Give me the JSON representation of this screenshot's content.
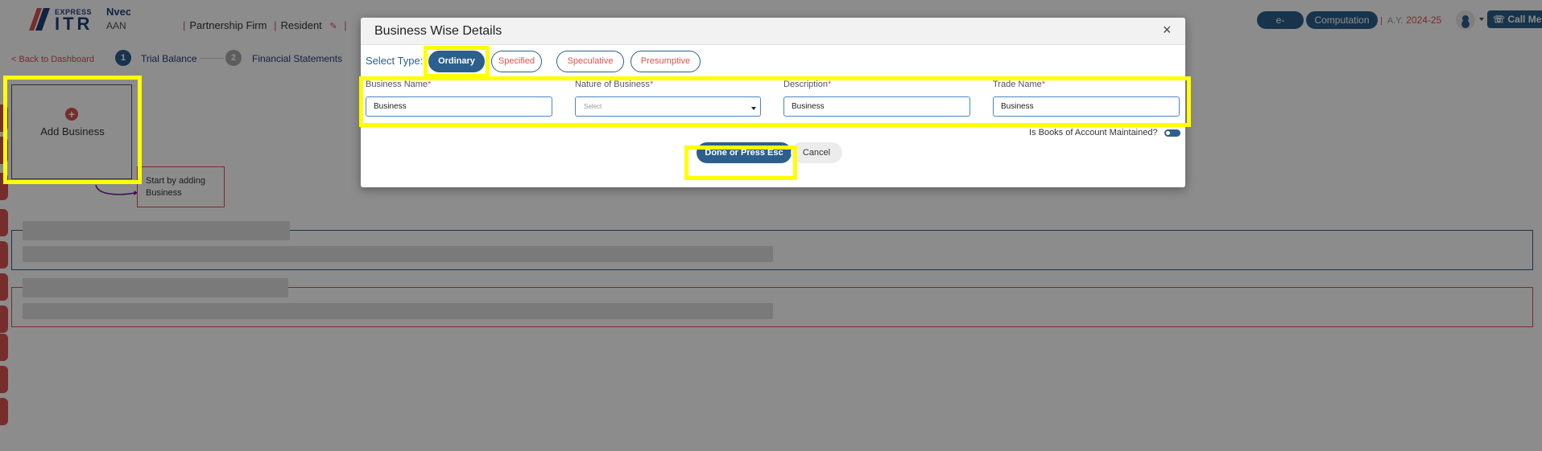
{
  "colors": {
    "brand_blue": "#2c5f8d",
    "accent_red": "#d9534f",
    "highlight_yellow": "#ffff00"
  },
  "header": {
    "logo": {
      "express": "EXPRESS",
      "itr": "ITR"
    },
    "client_name": "Nvec",
    "client_pan": "AAN",
    "client_type": "Partnership Firm",
    "residency": "Resident",
    "efiling_label": "e-Filing",
    "computation_label": "Computation",
    "ay_label": "A.Y.",
    "ay_value": "2024-25",
    "call_label": "Call Me",
    "icons": {
      "edit": "pencil-icon",
      "user": "user-icon",
      "phone": "phone-icon"
    }
  },
  "steps": {
    "back_label": "< Back to Dashboard",
    "items": [
      {
        "num": "1",
        "label": "Trial Balance"
      },
      {
        "num": "2",
        "label": "Financial Statements"
      }
    ]
  },
  "main": {
    "add_business_label": "Add Business",
    "hint_text": "Start by adding Business"
  },
  "modal": {
    "title": "Business Wise Details",
    "close": "×",
    "select_type_label": "Select Type:",
    "types": [
      {
        "label": "Ordinary",
        "active": true
      },
      {
        "label": "Specified",
        "active": false
      },
      {
        "label": "Speculative",
        "active": false
      },
      {
        "label": "Presumptive",
        "active": false
      }
    ],
    "fields": {
      "business_name": {
        "label": "Business Name",
        "value": "Business"
      },
      "nature_of_business": {
        "label": "Nature of Business",
        "placeholder": "Select"
      },
      "description": {
        "label": "Description",
        "value": "Business"
      },
      "trade_name": {
        "label": "Trade Name",
        "value": "Business"
      }
    },
    "required_mark": "*",
    "books_label": "Is Books of Account Maintained?",
    "books_maintained": true,
    "done_label": "Done or Press Esc",
    "cancel_label": "Cancel"
  }
}
